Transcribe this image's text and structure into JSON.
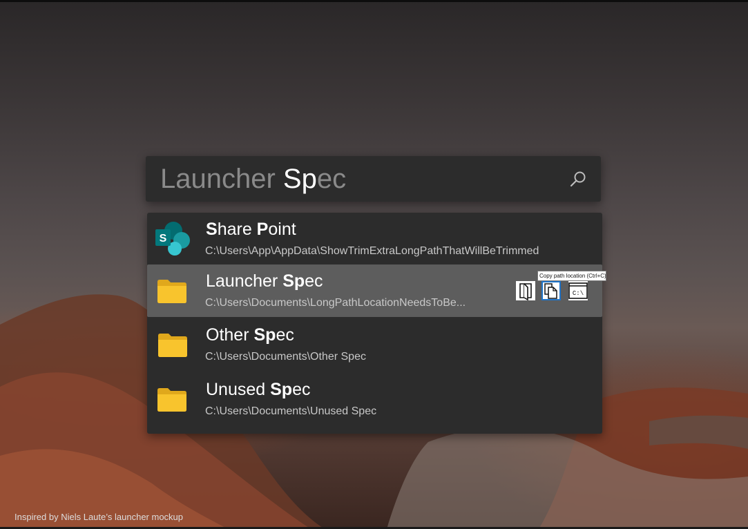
{
  "search": {
    "query_dim": "Launcher ",
    "query_match": "Sp",
    "query_rest": "ec"
  },
  "results": [
    {
      "title_parts": [
        {
          "text": "S",
          "bold": true
        },
        {
          "text": "hare ",
          "bold": false
        },
        {
          "text": "P",
          "bold": true
        },
        {
          "text": "oint",
          "bold": false
        }
      ],
      "path": "C:\\Users\\App\\AppData\\ShowTrimExtraLongPathThatWillBeTrimmed",
      "icon": "sharepoint-icon"
    },
    {
      "title_parts": [
        {
          "text": "Launcher ",
          "bold": false
        },
        {
          "text": "Sp",
          "bold": true
        },
        {
          "text": "ec",
          "bold": false
        }
      ],
      "path": "C:\\Users\\Documents\\LongPathLocationNeedsToBe...",
      "icon": "folder-icon",
      "selected": true
    },
    {
      "title_parts": [
        {
          "text": "Other ",
          "bold": false
        },
        {
          "text": "Sp",
          "bold": true
        },
        {
          "text": "ec",
          "bold": false
        }
      ],
      "path": "C:\\Users\\Documents\\Other Spec",
      "icon": "folder-icon"
    },
    {
      "title_parts": [
        {
          "text": "Unused ",
          "bold": false
        },
        {
          "text": "Sp",
          "bold": true
        },
        {
          "text": "ec",
          "bold": false
        }
      ],
      "path": "C:\\Users\\Documents\\Unused Spec",
      "icon": "folder-icon"
    }
  ],
  "actions": {
    "open_containing_folder_icon": "open-folder-icon",
    "copy_path_icon": "copy-icon",
    "open_in_console_icon": "console-icon",
    "console_glyph": "C:\\",
    "tooltip": "Copy path location (Ctrl+C)"
  },
  "footer": {
    "credit": "Inspired by Niels Laute’s launcher mockup"
  },
  "colors": {
    "panel": "#2c2c2c",
    "selected_row": "#5d5d5d",
    "folder": "#f8c42d",
    "focus_border": "#1e74c9",
    "sharepoint_dark": "#036c70",
    "sharepoint_mid": "#1a9ba1",
    "sharepoint_light": "#37c6d0"
  }
}
